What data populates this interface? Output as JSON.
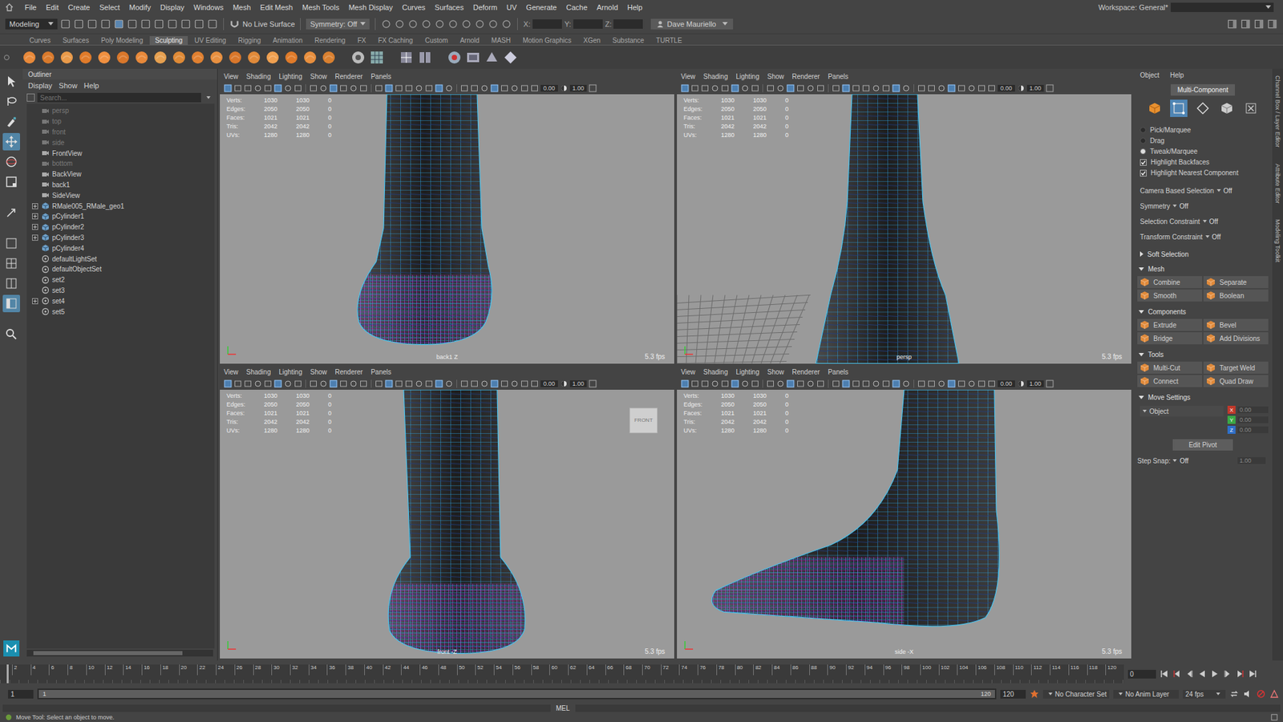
{
  "menubar": {
    "items": [
      "File",
      "Edit",
      "Create",
      "Select",
      "Modify",
      "Display",
      "Windows",
      "Mesh",
      "Edit Mesh",
      "Mesh Tools",
      "Mesh Display",
      "Curves",
      "Surfaces",
      "Deform",
      "UV",
      "Generate",
      "Cache",
      "Arnold",
      "Help"
    ],
    "workspace": "Workspace: General*"
  },
  "status_line": {
    "mode": "Modeling",
    "live_surface": "No Live Surface",
    "symmetry": "Symmetry: Off",
    "fields": [
      "X:",
      "Y:",
      "Z:"
    ],
    "user": "Dave Mauriello"
  },
  "shelf": {
    "tabs": [
      {
        "label": "Curves",
        "selected": false
      },
      {
        "label": "Surfaces",
        "selected": false
      },
      {
        "label": "Poly Modeling",
        "selected": false
      },
      {
        "label": "Sculpting",
        "selected": true
      },
      {
        "label": "UV Editing",
        "selected": false
      },
      {
        "label": "Rigging",
        "selected": false
      },
      {
        "label": "Animation",
        "selected": false
      },
      {
        "label": "Rendering",
        "selected": false
      },
      {
        "label": "FX",
        "selected": false
      },
      {
        "label": "FX Caching",
        "selected": false
      },
      {
        "label": "Custom",
        "selected": false
      },
      {
        "label": "Arnold",
        "selected": false
      },
      {
        "label": "MASH",
        "selected": false
      },
      {
        "label": "Motion Graphics",
        "selected": false
      },
      {
        "label": "XGen",
        "selected": false
      },
      {
        "label": "Substance",
        "selected": false
      },
      {
        "label": "TURTLE",
        "selected": false
      }
    ]
  },
  "toolbox": {
    "tools": [
      {
        "kind": "select",
        "selected": false
      },
      {
        "kind": "lasso",
        "selected": false
      },
      {
        "kind": "paint",
        "selected": false
      },
      {
        "kind": "move",
        "selected": true
      },
      {
        "kind": "rotate",
        "selected": false
      },
      {
        "kind": "scale",
        "selected": false
      },
      {
        "kind": "last",
        "selected": false
      },
      {
        "kind": "layout-single",
        "selected": false
      },
      {
        "kind": "layout-quad",
        "selected": false
      },
      {
        "kind": "layout-split",
        "selected": false
      },
      {
        "kind": "layout-outliner",
        "selected": true
      },
      {
        "kind": "search",
        "selected": false
      }
    ]
  },
  "outliner": {
    "title": "Outliner",
    "menu": [
      "Display",
      "Show",
      "Help"
    ],
    "search_placeholder": "Search...",
    "items": [
      {
        "label": "persp",
        "kind": "camera",
        "dimmed": true,
        "expandable": false
      },
      {
        "label": "top",
        "kind": "camera",
        "dimmed": true,
        "expandable": false
      },
      {
        "label": "front",
        "kind": "camera",
        "dimmed": true,
        "expandable": false
      },
      {
        "label": "side",
        "kind": "camera",
        "dimmed": true,
        "expandable": false
      },
      {
        "label": "FrontView",
        "kind": "camera",
        "dimmed": false,
        "expandable": false
      },
      {
        "label": "bottom",
        "kind": "camera",
        "dimmed": true,
        "expandable": false
      },
      {
        "label": "BackView",
        "kind": "camera",
        "dimmed": false,
        "expandable": false
      },
      {
        "label": "back1",
        "kind": "camera",
        "dimmed": false,
        "expandable": false
      },
      {
        "label": "SideView",
        "kind": "camera",
        "dimmed": false,
        "expandable": false
      },
      {
        "label": "RMale005_RMale_geo1",
        "kind": "mesh",
        "dimmed": false,
        "expandable": true
      },
      {
        "label": "pCylinder1",
        "kind": "mesh",
        "dimmed": false,
        "expandable": true
      },
      {
        "label": "pCylinder2",
        "kind": "mesh",
        "dimmed": false,
        "expandable": true
      },
      {
        "label": "pCylinder3",
        "kind": "mesh",
        "dimmed": false,
        "expandable": true
      },
      {
        "label": "pCylinder4",
        "kind": "mesh",
        "dimmed": false,
        "expandable": false
      },
      {
        "label": "defaultLightSet",
        "kind": "set",
        "dimmed": false,
        "expandable": false
      },
      {
        "label": "defaultObjectSet",
        "kind": "set",
        "dimmed": false,
        "expandable": false
      },
      {
        "label": "set2",
        "kind": "set",
        "dimmed": false,
        "expandable": false
      },
      {
        "label": "set3",
        "kind": "set",
        "dimmed": false,
        "expandable": false
      },
      {
        "label": "set4",
        "kind": "set",
        "dimmed": false,
        "expandable": true
      },
      {
        "label": "set5",
        "kind": "set",
        "dimmed": false,
        "expandable": false
      }
    ]
  },
  "viewport_menu": [
    "View",
    "Shading",
    "Lighting",
    "Show",
    "Renderer",
    "Panels"
  ],
  "viewport_fields": {
    "exposure": "0.00",
    "gamma": "1.00"
  },
  "hud": [
    {
      "label": "Verts:",
      "values": [
        "1030",
        "1030",
        "0"
      ]
    },
    {
      "label": "Edges:",
      "values": [
        "2050",
        "2050",
        "0"
      ]
    },
    {
      "label": "Faces:",
      "values": [
        "1021",
        "1021",
        "0"
      ]
    },
    {
      "label": "Tris:",
      "values": [
        "2042",
        "2042",
        "0"
      ]
    },
    {
      "label": "UVs:",
      "values": [
        "1280",
        "1280",
        "0"
      ]
    }
  ],
  "viewports": [
    {
      "kind": "back",
      "camera": "back1 Z",
      "fps": "5.3 fps",
      "view_cube": ""
    },
    {
      "kind": "persp",
      "camera": "persp",
      "fps": "5.3 fps",
      "view_cube": ""
    },
    {
      "kind": "front",
      "camera": "front -Z",
      "fps": "5.3 fps",
      "view_cube": "FRONT"
    },
    {
      "kind": "side",
      "camera": "side -X",
      "fps": "5.3 fps",
      "view_cube": ""
    }
  ],
  "modeling_toolkit": {
    "menu": [
      "Object",
      "Help"
    ],
    "mode_button": "Multi-Component",
    "components": [
      {
        "kind": "object",
        "selected": false
      },
      {
        "kind": "vertex",
        "selected": true
      },
      {
        "kind": "edge",
        "selected": false
      },
      {
        "kind": "face",
        "selected": false
      },
      {
        "kind": "uv",
        "selected": false
      }
    ],
    "selection_modes": [
      {
        "label": "Pick/Marquee",
        "selected": false
      },
      {
        "label": "Drag",
        "selected": false
      },
      {
        "label": "Tweak/Marquee",
        "selected": true
      }
    ],
    "checkboxes": [
      {
        "label": "Highlight Backfaces",
        "checked": true
      },
      {
        "label": "Highlight Nearest Component",
        "checked": true
      }
    ],
    "options": [
      {
        "label": "Camera Based Selection",
        "value": "Off"
      },
      {
        "label": "Symmetry",
        "value": "Off"
      },
      {
        "label": "Selection Constraint",
        "value": "Off"
      },
      {
        "label": "Transform Constraint",
        "value": "Off"
      }
    ],
    "sections": [
      {
        "title": "Soft Selection",
        "expanded": false,
        "buttons": []
      },
      {
        "title": "Mesh",
        "expanded": true,
        "buttons": [
          "Combine",
          "Separate",
          "Smooth",
          "Boolean"
        ]
      },
      {
        "title": "Components",
        "expanded": true,
        "buttons": [
          "Extrude",
          "Bevel",
          "Bridge",
          "Add Divisions"
        ]
      },
      {
        "title": "Tools",
        "expanded": true,
        "buttons": [
          "Multi-Cut",
          "Target Weld",
          "Connect",
          "Quad Draw"
        ]
      }
    ],
    "move_settings": {
      "title": "Move Settings",
      "expanded": true,
      "space": "Object",
      "axes": [
        {
          "label": "X",
          "value": "0.00",
          "color": "#c0392b"
        },
        {
          "label": "Y",
          "value": "0.00",
          "color": "#3aa845"
        },
        {
          "label": "Z",
          "value": "0.00",
          "color": "#2f6fc8"
        }
      ],
      "edit_pivot": "Edit Pivot",
      "step_snap": "Step Snap:",
      "step_value": "Off",
      "step_amount": "1.00"
    }
  },
  "side_tabs": [
    "Channel Box / Layer Editor",
    "Attribute Editor",
    "Modeling Toolkit"
  ],
  "timeline": {
    "ticks": [
      "2",
      "4",
      "6",
      "8",
      "10",
      "12",
      "14",
      "16",
      "18",
      "20",
      "22",
      "24",
      "26",
      "28",
      "30",
      "32",
      "34",
      "36",
      "38",
      "40",
      "42",
      "44",
      "46",
      "48",
      "50",
      "52",
      "54",
      "56",
      "58",
      "60",
      "62",
      "64",
      "66",
      "68",
      "70",
      "72",
      "74",
      "76",
      "78",
      "80",
      "82",
      "84",
      "86",
      "88",
      "90",
      "92",
      "94",
      "96",
      "98",
      "100",
      "102",
      "104",
      "106",
      "108",
      "110",
      "112",
      "114",
      "116",
      "118",
      "120"
    ],
    "current_frame": "0"
  },
  "range": {
    "start": "1",
    "playback_start": "1",
    "playback_end": "120",
    "end": "120",
    "character_set": "No Character Set",
    "anim_layer": "No Anim Layer",
    "fps": "24 fps"
  },
  "command_line": {
    "language": "MEL"
  },
  "help_line": "Move Tool: Select an object to move."
}
